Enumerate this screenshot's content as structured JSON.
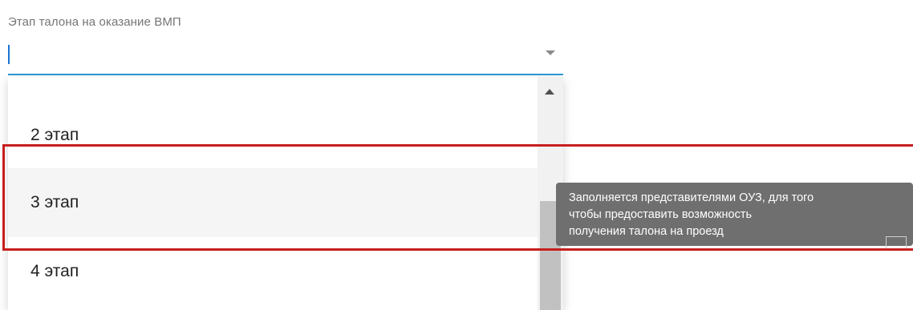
{
  "field": {
    "label": "Этап талона на оказание ВМП",
    "value": ""
  },
  "dropdown": {
    "options": [
      {
        "label": "2 этап",
        "highlighted": false
      },
      {
        "label": "3 этап",
        "highlighted": true
      },
      {
        "label": "4 этап",
        "highlighted": false
      }
    ]
  },
  "tooltip": {
    "text": "Заполняется представителями ОУЗ, для того\nчтобы предоставить возможность\nполучения талона на проезд"
  },
  "icons": {
    "select_arrow": "chevron-down-icon",
    "scroll_up": "arrow-up-icon"
  },
  "colors": {
    "focus_underline": "#2e9ad8",
    "highlight_border": "#c81e1e",
    "tooltip_bg": "#6f6f6f",
    "hovered_option_bg": "#f5f5f5"
  }
}
